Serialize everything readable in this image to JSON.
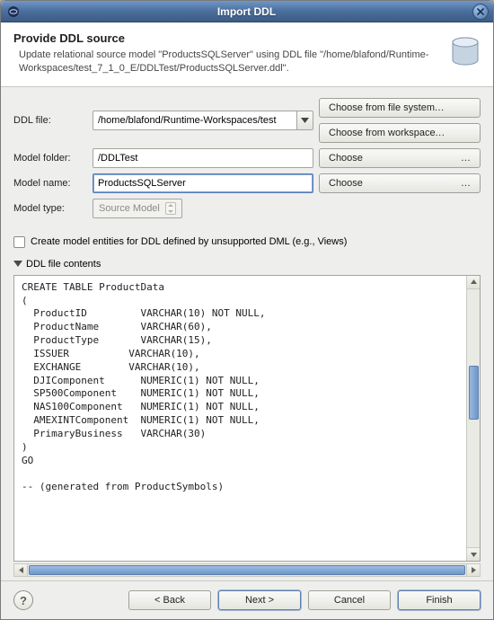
{
  "window": {
    "title": "Import DDL"
  },
  "header": {
    "heading": "Provide DDL source",
    "description": "Update relational source model \"ProductsSQLServer\" using DDL file \"/home/blafond/Runtime-Workspaces/test_7_1_0_E/DDLTest/ProductsSQLServer.ddl\"."
  },
  "form": {
    "ddl_file_label": "DDL file:",
    "ddl_file_value": "/home/blafond/Runtime-Workspaces/test",
    "choose_fs_label": "Choose from file system",
    "choose_ws_label": "Choose from workspace",
    "model_folder_label": "Model folder:",
    "model_folder_value": "/DDLTest",
    "model_name_label": "Model name:",
    "model_name_value": "ProductsSQLServer",
    "model_type_label": "Model type:",
    "model_type_value": "Source Model",
    "choose_label": "Choose",
    "ellipsis": "..."
  },
  "checkbox": {
    "label": "Create model entities for DDL defined by unsupported DML (e.g., Views)"
  },
  "disclosure": {
    "label": "DDL file contents"
  },
  "ddl_contents": "CREATE TABLE ProductData\n(\n  ProductID         VARCHAR(10) NOT NULL,\n  ProductName       VARCHAR(60),\n  ProductType       VARCHAR(15),\n  ISSUER          VARCHAR(10),\n  EXCHANGE        VARCHAR(10),\n  DJIComponent      NUMERIC(1) NOT NULL,\n  SP500Component    NUMERIC(1) NOT NULL,\n  NAS100Component   NUMERIC(1) NOT NULL,\n  AMEXINTComponent  NUMERIC(1) NOT NULL,\n  PrimaryBusiness   VARCHAR(30)\n)\nGO\n\n-- (generated from ProductSymbols)",
  "footer": {
    "back": "< Back",
    "next": "Next >",
    "cancel": "Cancel",
    "finish": "Finish"
  }
}
